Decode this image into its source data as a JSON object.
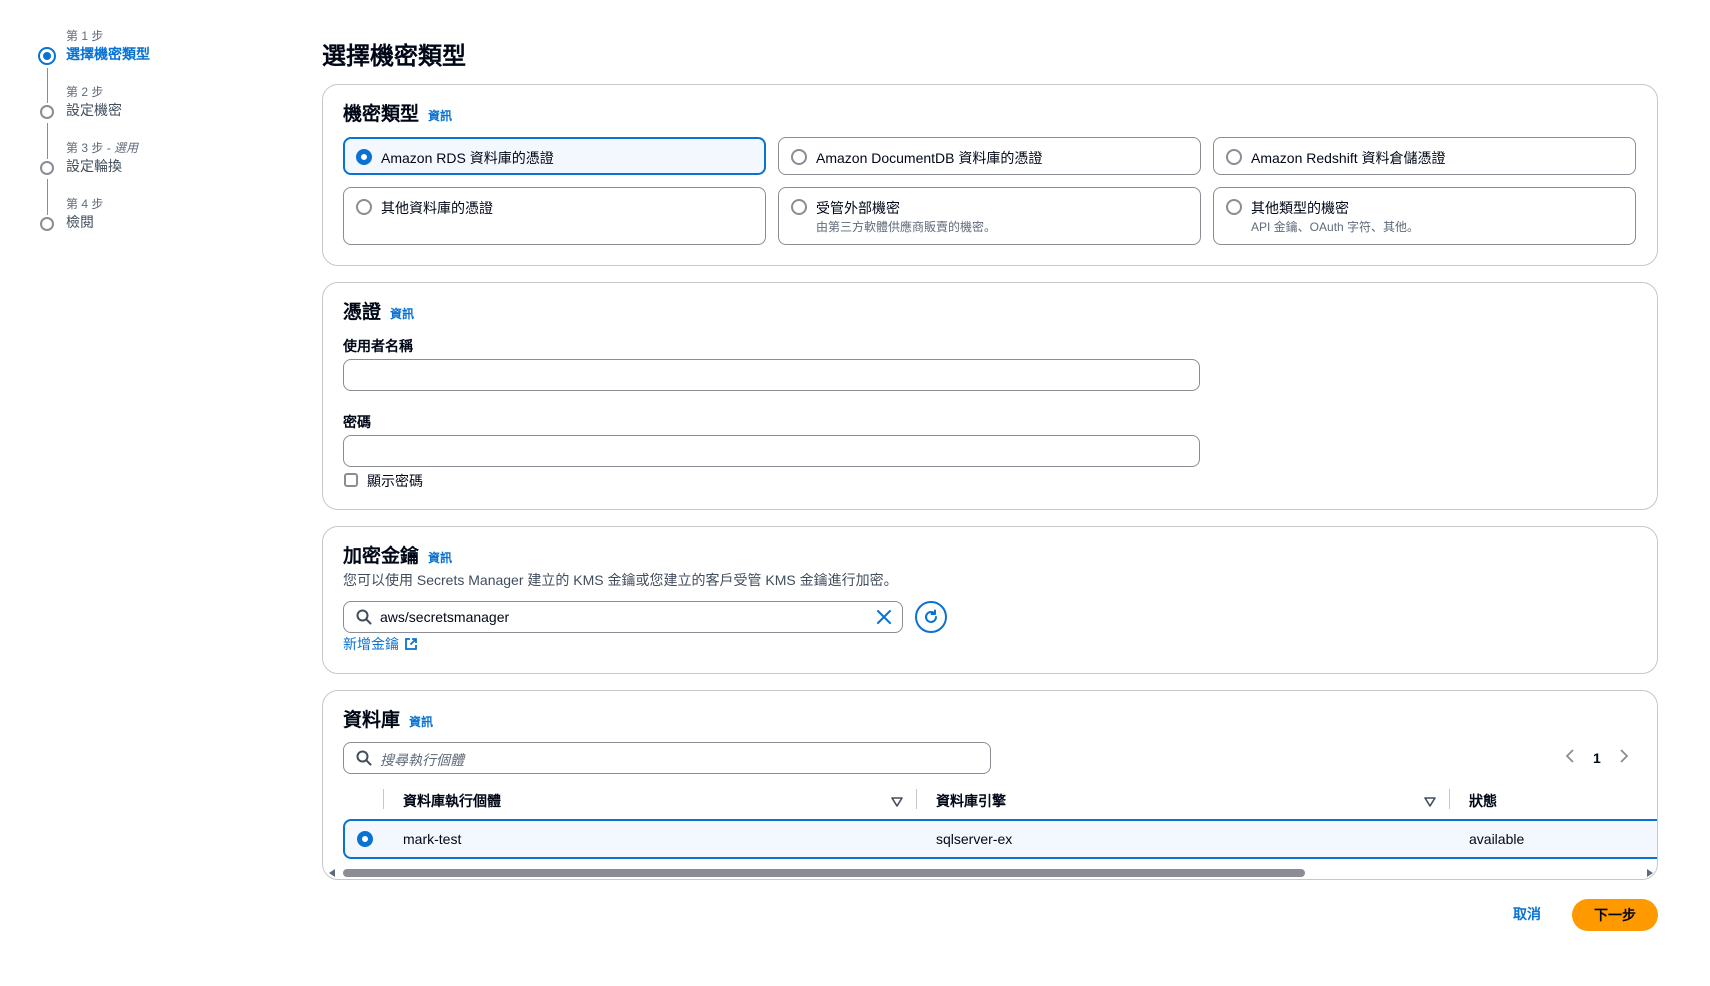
{
  "steps": [
    {
      "number": "第 1 步",
      "optional": "",
      "title": "選擇機密類型",
      "active": true
    },
    {
      "number": "第 2 步",
      "optional": "",
      "title": "設定機密",
      "active": false
    },
    {
      "number": "第 3 步",
      "optional": " - 選用",
      "title": "設定輪換",
      "active": false
    },
    {
      "number": "第 4 步",
      "optional": "",
      "title": "檢閱",
      "active": false
    }
  ],
  "page_title": "選擇機密類型",
  "info_label": "資訊",
  "secret_type": {
    "title": "機密類型",
    "options": [
      {
        "label": "Amazon RDS 資料庫的憑證",
        "description": "",
        "selected": true
      },
      {
        "label": "Amazon DocumentDB 資料庫的憑證",
        "description": "",
        "selected": false
      },
      {
        "label": "Amazon Redshift 資料倉儲憑證",
        "description": "",
        "selected": false
      },
      {
        "label": "其他資料庫的憑證",
        "description": "",
        "selected": false
      },
      {
        "label": "受管外部機密",
        "description": "由第三方軟體供應商販賣的機密。",
        "selected": false
      },
      {
        "label": "其他類型的機密",
        "description": "API 金鑰、OAuth 字符、其他。",
        "selected": false
      }
    ]
  },
  "credentials": {
    "title": "憑證",
    "username_label": "使用者名稱",
    "username_value": "",
    "password_label": "密碼",
    "password_value": "",
    "show_password_label": "顯示密碼"
  },
  "encryption": {
    "title": "加密金鑰",
    "description": "您可以使用 Secrets Manager 建立的 KMS 金鑰或您建立的客戶受管 KMS 金鑰進行加密。",
    "key_value": "aws/secretsmanager",
    "add_key_link": "新增金鑰"
  },
  "database": {
    "title": "資料庫",
    "search_placeholder": "搜尋執行個體",
    "current_page": "1",
    "columns": [
      "資料庫執行個體",
      "資料庫引擎",
      "狀態"
    ],
    "rows": [
      {
        "instance": "mark-test",
        "engine": "sqlserver-ex",
        "status": "available",
        "selected": true
      }
    ]
  },
  "footer": {
    "cancel_label": "取消",
    "next_label": "下一步"
  },
  "colors": {
    "accent": "#0972d3",
    "primary_button": "#ff9900",
    "selected_bg": "#f2f8fd",
    "border": "#8c8c94"
  }
}
